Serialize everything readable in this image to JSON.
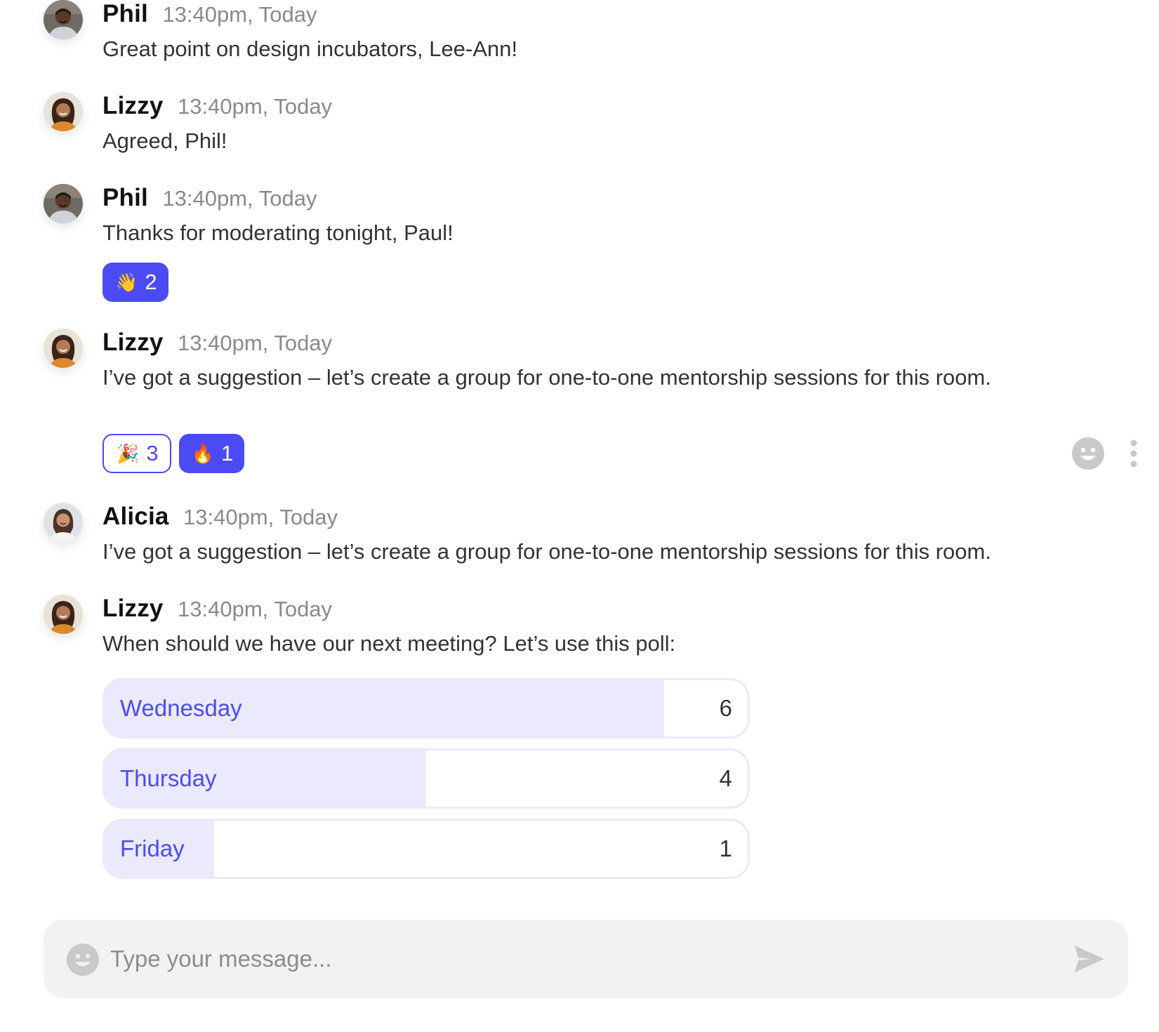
{
  "messages": [
    {
      "name": "Phil",
      "time": "13:40pm, Today",
      "text": "Great point on design incubators, Lee-Ann!",
      "avatar": "phil-avatar"
    },
    {
      "name": "Lizzy",
      "time": "13:40pm, Today",
      "text": "Agreed, Phil!",
      "avatar": "lizzy-avatar"
    },
    {
      "name": "Phil",
      "time": "13:40pm, Today",
      "text": "Thanks for moderating tonight, Paul!",
      "avatar": "phil-avatar",
      "reactions": [
        {
          "emoji": "👋",
          "count": "2",
          "style": "filled"
        }
      ]
    },
    {
      "name": "Lizzy",
      "time": "13:40pm, Today",
      "text": "I’ve got a suggestion – let’s create a group for one-to-one mentorship sessions for this room.",
      "avatar": "lizzy-avatar",
      "reactions": [
        {
          "emoji": "🎉",
          "count": "3",
          "style": "outline"
        },
        {
          "emoji": "🔥",
          "count": "1",
          "style": "filled"
        }
      ],
      "actions": [
        "smile-icon",
        "kebab-icon"
      ]
    },
    {
      "name": "Alicia",
      "time": "13:40pm, Today",
      "text": "I’ve got a suggestion – let’s create a group for one-to-one mentorship sessions for this room.",
      "avatar": "alicia-avatar"
    },
    {
      "name": "Lizzy",
      "time": "13:40pm, Today",
      "text": "When should we have our next meeting? Let’s use this poll:",
      "avatar": "lizzy-avatar"
    }
  ],
  "poll": {
    "options": [
      {
        "label": "Wednesday",
        "count": "6",
        "fraction": 0.87
      },
      {
        "label": "Thursday",
        "count": "4",
        "fraction": 0.5
      },
      {
        "label": "Friday",
        "count": "1",
        "fraction": 0.17
      }
    ]
  },
  "composer": {
    "placeholder": "Type your message...",
    "emoji_icon": "smile-icon",
    "send_icon": "send-icon"
  },
  "colors": {
    "accent": "#4b4bf5",
    "poll_fill": "#eaeafc",
    "timestamp": "#8a8a8a",
    "composer_bg": "#f2f2f2",
    "icon_gray": "#c9c9c9"
  }
}
